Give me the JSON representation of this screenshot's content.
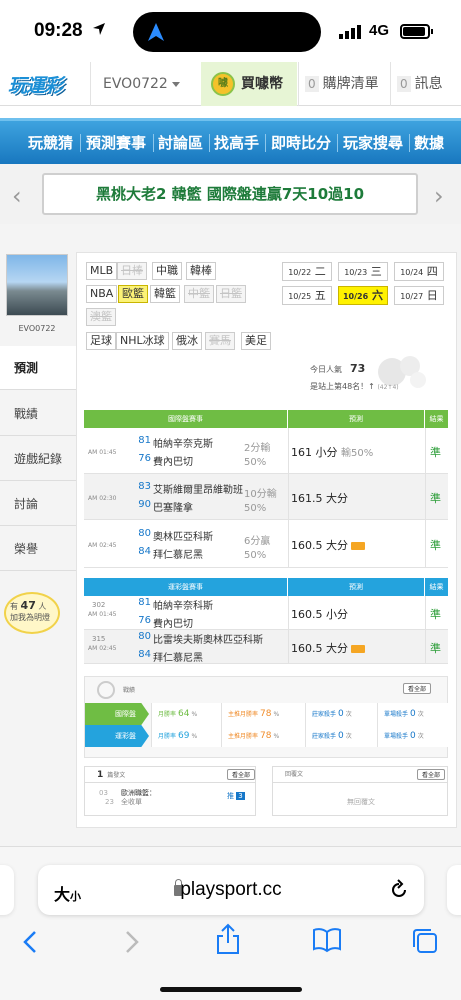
{
  "status": {
    "time": "09:28",
    "network": "4G"
  },
  "header": {
    "logo": "玩運彩",
    "account": "EVO0722",
    "coin_label": "買噱幣",
    "coin_icon_text": "噱",
    "purchase": {
      "count": "0",
      "label": "購牌清單"
    },
    "messages": {
      "count": "0",
      "label": "訊息"
    }
  },
  "nav": [
    "玩競猜",
    "預測賽事",
    "討論區",
    "找高手",
    "即時比分",
    "玩家搜尋",
    "數據"
  ],
  "banner": {
    "text": "黑桃大老2 韓籃 國際盤連贏7天10過10",
    "prev": "‹",
    "next": "›"
  },
  "profile": {
    "name": "EVO0722"
  },
  "sidebar": {
    "tabs": [
      "預測",
      "戰績",
      "遊戲紀錄",
      "討論",
      "榮譽"
    ],
    "bulb": {
      "prefix": "有",
      "count": "47",
      "unit": "人",
      "suffix": "加我為明燈"
    }
  },
  "leagues": [
    {
      "label": "MLB",
      "state": "normal"
    },
    {
      "label": "日棒",
      "state": "disabled"
    },
    {
      "label": "中職",
      "state": "normal"
    },
    {
      "label": "韓棒",
      "state": "normal"
    },
    {
      "label": "NBA",
      "state": "normal"
    },
    {
      "label": "歐籃",
      "state": "selected"
    },
    {
      "label": "韓籃",
      "state": "normal"
    },
    {
      "label": "中籃",
      "state": "disabled"
    },
    {
      "label": "日籃",
      "state": "disabled"
    },
    {
      "label": "澳籃",
      "state": "disabled"
    },
    {
      "label": "足球",
      "state": "normal"
    },
    {
      "label": "NHL冰球",
      "state": "normal"
    },
    {
      "label": "俄冰",
      "state": "normal"
    },
    {
      "label": "賽馬",
      "state": "disabled"
    },
    {
      "label": "美足",
      "state": "normal"
    }
  ],
  "dates": [
    {
      "date": "10/22",
      "day": "二",
      "selected": false
    },
    {
      "date": "10/23",
      "day": "三",
      "selected": false
    },
    {
      "date": "10/24",
      "day": "四",
      "selected": false
    },
    {
      "date": "10/25",
      "day": "五",
      "selected": false
    },
    {
      "date": "10/26",
      "day": "六",
      "selected": true
    },
    {
      "date": "10/27",
      "day": "日",
      "selected": false
    }
  ],
  "popularity": {
    "label": "今日人氣",
    "value": "73",
    "rank_text": "是站上第48名！↑",
    "rank_extra": "(42↑4)"
  },
  "intl_table": {
    "headers": [
      "國際盤賽事",
      "預測",
      "結果"
    ],
    "rows": [
      {
        "time": "AM 01:45",
        "away_odds": "81",
        "away": "帕納辛奈克斯",
        "home_odds": "76",
        "home": "費內巴切",
        "hcap": "2分輸",
        "hcap2": "50%",
        "pick": "161 小分",
        "pick_sub": "輸50%",
        "hot": false,
        "result": "準"
      },
      {
        "time": "AM 02:30",
        "away_odds": "83",
        "away": "艾斯維爾里昂維勒班",
        "home_odds": "90",
        "home": "巴塞隆拿",
        "hcap": "10分輸",
        "hcap2": "50%",
        "pick": "161.5 大分",
        "pick_sub": "",
        "hot": false,
        "result": "準"
      },
      {
        "time": "AM 02:45",
        "away_odds": "80",
        "away": "奧林匹亞科斯",
        "home_odds": "84",
        "home": "拜仁慕尼黑",
        "hcap": "6分贏",
        "hcap2": "50%",
        "pick": "160.5 大分",
        "pick_sub": "",
        "hot": true,
        "result": "準"
      }
    ]
  },
  "sports_table": {
    "headers": [
      "運彩盤賽事",
      "預測",
      "結果"
    ],
    "rows": [
      {
        "no": "302",
        "time": "AM 01:45",
        "away_odds": "81",
        "away": "帕納辛奈科斯",
        "home_odds": "76",
        "home": "費內巴切",
        "pick": "160.5 小分",
        "hot": false,
        "result": "準"
      },
      {
        "no": "315",
        "time": "AM 02:45",
        "away_odds": "80",
        "away": "比雷埃夫斯奧林匹亞科斯",
        "home_odds": "84",
        "home": "拜仁慕尼黑",
        "pick": "160.5 大分",
        "hot": true,
        "result": "準"
      }
    ]
  },
  "stats": {
    "title": "戰績",
    "view_all": "看全部",
    "rows": [
      {
        "tag": "國際盤",
        "color": "#6fbd44",
        "month_label": "月勝率",
        "month": "64",
        "main_label": "主推月勝率",
        "main": "78",
        "house_label": "莊家殺手",
        "house": "0",
        "wang_label": "單場殺手",
        "wang": "0",
        "unit": "次",
        "pct": "%"
      },
      {
        "tag": "運彩盤",
        "color": "#24a3dd",
        "month_label": "月勝率",
        "month": "69",
        "main_label": "主推月勝率",
        "main": "78",
        "house_label": "莊家殺手",
        "house": "0",
        "wang_label": "單場殺手",
        "wang": "0",
        "unit": "次",
        "pct": "%"
      }
    ]
  },
  "posts": {
    "count": "1",
    "label": "篇發文",
    "view_all": "看全部",
    "date_m": "03",
    "date_d": "23",
    "item_title": "歐洲職籃：",
    "item_sub": "全收單",
    "tag": "推",
    "push": "3"
  },
  "replies": {
    "label": "回覆文",
    "view_all": "看全部",
    "empty": "無回覆文"
  },
  "safari": {
    "aa": "大",
    "aa_small": "小",
    "url": "playsport.cc"
  },
  "colors": {
    "brand_blue": "#1877bf",
    "accent_green": "#6fbd44",
    "accent_blue": "#24a3dd",
    "selected_yellow": "#fff200"
  }
}
